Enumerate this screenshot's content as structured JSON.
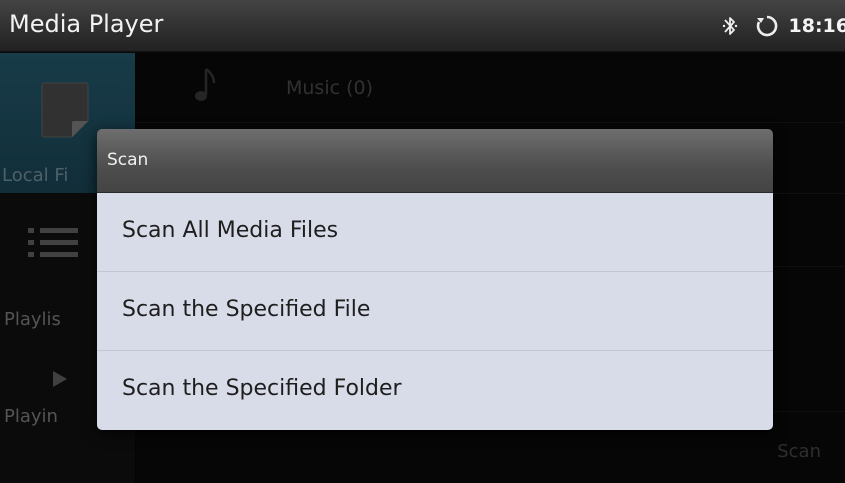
{
  "status_bar": {
    "app_title": "Media Player",
    "time": "18:16",
    "icons": [
      "bluetooth-icon",
      "sync-icon"
    ]
  },
  "sidebar": {
    "items": [
      {
        "label": "Local Fi",
        "icon": "document-icon",
        "selected": true
      },
      {
        "label": "Playlis",
        "icon": "list-icon",
        "selected": false
      },
      {
        "label": "Playin",
        "icon": "play-icon",
        "selected": false
      }
    ]
  },
  "content": {
    "music_label": "Music  (0)",
    "scan_label": "Scan"
  },
  "dialog": {
    "title": "Scan",
    "options": [
      {
        "label": "Scan All Media Files"
      },
      {
        "label": "Scan the Specified File"
      },
      {
        "label": "Scan the Specified Folder"
      }
    ]
  },
  "colors": {
    "accent": "#2c6d84",
    "dialog_list_bg": "#d8dce8",
    "header_bg": "#4e4e4e"
  }
}
